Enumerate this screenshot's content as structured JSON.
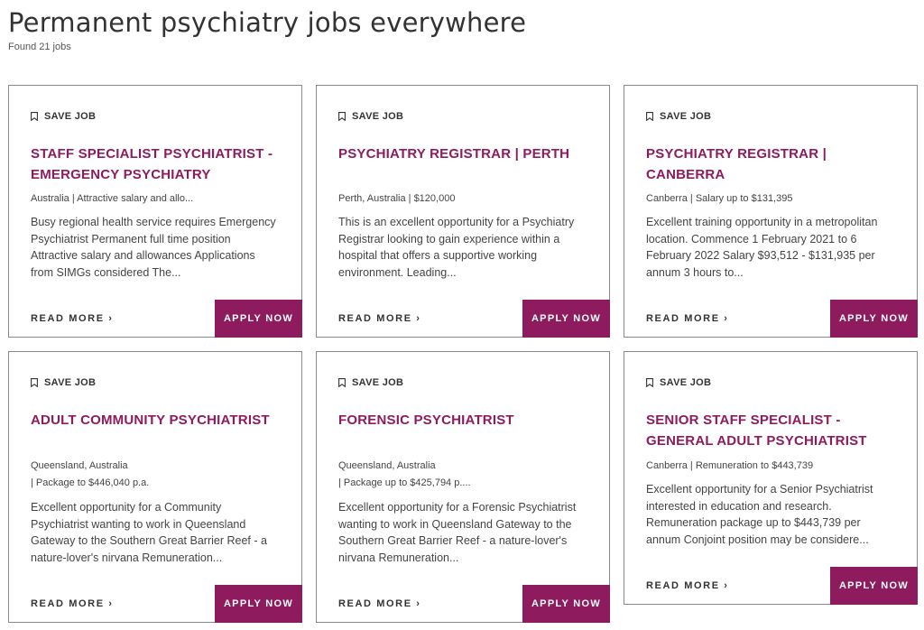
{
  "header": {
    "title": "Permanent psychiatry jobs everywhere",
    "results_count": "Found 21 jobs"
  },
  "save_label": "SAVE JOB",
  "read_more_label": "READ MORE ›",
  "apply_label": "APPLY NOW",
  "jobs": [
    {
      "title": "STAFF SPECIALIST PSYCHIATRIST - EMERGENCY PSYCHIATRY",
      "meta1": "Australia | Attractive salary and allo...",
      "meta2": "",
      "description": "Busy regional health service requires Emergency Psychiatrist  Permanent full time position Attractive salary and allowances Applications from SIMGs considered    The..."
    },
    {
      "title": "PSYCHIATRY REGISTRAR | PERTH",
      "meta1": "Perth, Australia | $120,000",
      "meta2": "",
      "description": "This is an excellent opportunity for a Psychiatry Registrar looking to gain experience within a hospital that offers a supportive working environment. Leading..."
    },
    {
      "title": "PSYCHIATRY REGISTRAR | CANBERRA",
      "meta1": "Canberra | Salary up to $131,395",
      "meta2": "",
      "description": "Excellent training opportunity in a metropolitan location.    Commence 1 February 2021 to 6 February 2022 Salary $93,512 - $131,935 per annum  3 hours to..."
    },
    {
      "title": "ADULT COMMUNITY PSYCHIATRIST",
      "meta1": "Queensland, Australia",
      "meta2": "| Package to $446,040 p.a.",
      "description": "Excellent opportunity for a Community Psychiatrist wanting to work in Queensland Gateway to the Southern Great Barrier Reef - a nature-lover's nirvana Remuneration..."
    },
    {
      "title": "FORENSIC PSYCHIATRIST",
      "meta1": "Queensland, Australia",
      "meta2": "| Package up to $425,794 p....",
      "description": "Excellent opportunity for a Forensic Psychiatrist wanting to work in Queensland Gateway to the Southern Great Barrier Reef - a nature-lover's nirvana Remuneration..."
    },
    {
      "title": "SENIOR STAFF SPECIALIST - GENERAL ADULT PSYCHIATRIST",
      "meta1": "Canberra | Remuneration to $443,739",
      "meta2": "",
      "description": "Excellent opportunity for a Senior Psychiatrist interested in education and research. Remuneration package up to $443,739 per annum  Conjoint position may be considere..."
    }
  ],
  "colors": {
    "accent": "#8e1b5d",
    "border": "#8a8a8a",
    "text": "#333333"
  }
}
